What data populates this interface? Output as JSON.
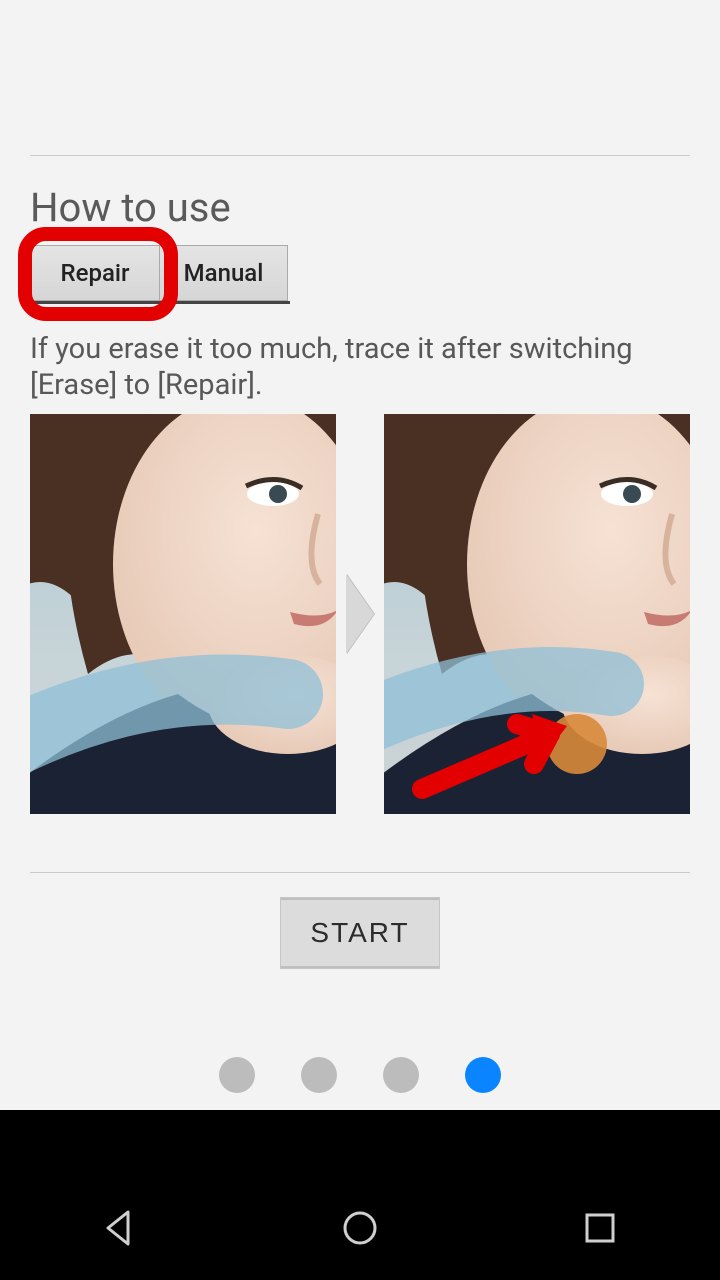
{
  "heading": "How to use",
  "tabs": {
    "repair": "Repair",
    "manual": "Manual"
  },
  "instruction": "If you erase it too much, trace it after switching [Erase] to [Repair].",
  "start_label": "START",
  "pager": {
    "count": 4,
    "active_index": 3
  },
  "colors": {
    "highlight": "#e30000",
    "accent": "#0a84ff",
    "repair_cursor": "#d88a3a",
    "erase_stroke": "#8fbfd7"
  }
}
